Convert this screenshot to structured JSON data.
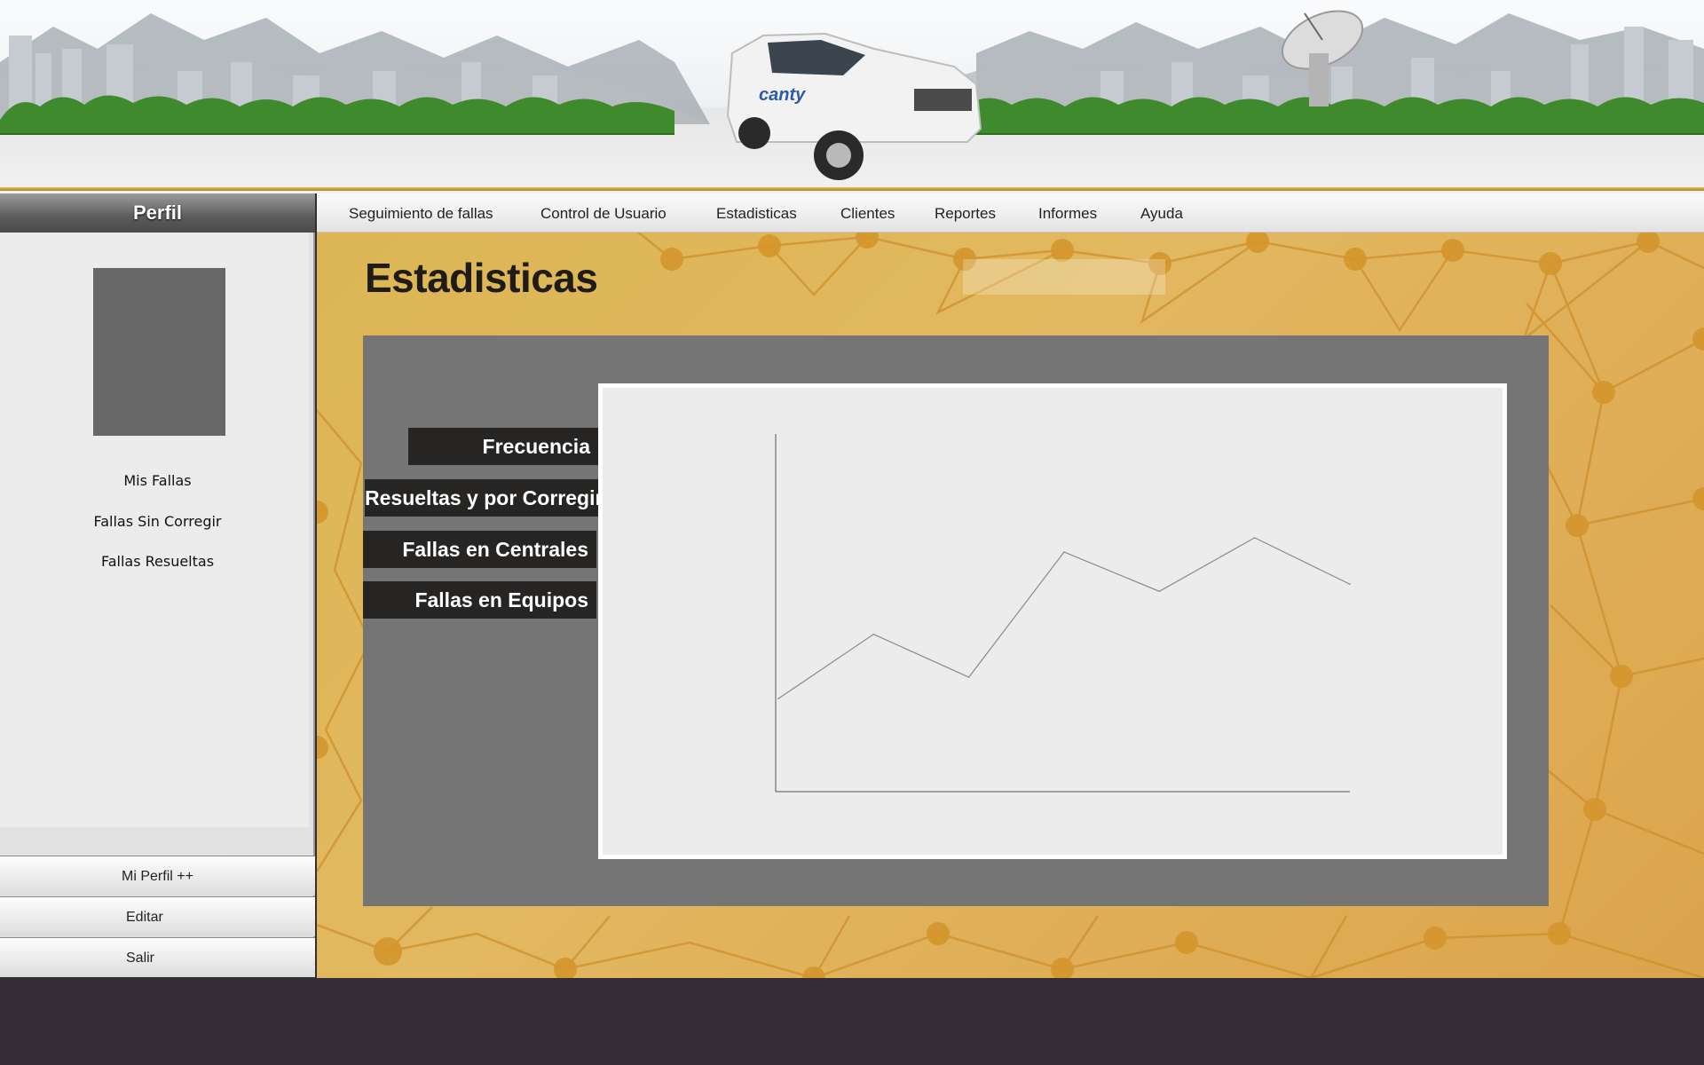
{
  "nav": {
    "items": [
      {
        "label": "Seguimiento de fallas"
      },
      {
        "label": "Control de Usuario"
      },
      {
        "label": "Estadisticas"
      },
      {
        "label": "Clientes"
      },
      {
        "label": "Reportes"
      },
      {
        "label": "Informes"
      },
      {
        "label": "Ayuda"
      }
    ]
  },
  "sidebar": {
    "header": "Perfil",
    "links": [
      {
        "label": "Mis Fallas"
      },
      {
        "label": "Fallas Sin Corregir"
      },
      {
        "label": "Fallas Resueltas"
      }
    ],
    "buttons": [
      {
        "label": "Mi Perfil ++"
      },
      {
        "label": "Editar"
      },
      {
        "label": "Salir"
      }
    ]
  },
  "main": {
    "title": "Estadisticas",
    "search_placeholder": "",
    "tabs": [
      {
        "label": "Frecuencia"
      },
      {
        "label": "Resueltas y por Corregir"
      },
      {
        "label": "Fallas en Centrales"
      },
      {
        "label": "Fallas en Equipos"
      }
    ]
  },
  "banner": {
    "truck_logo": "canty"
  },
  "colors": {
    "background": "#342d35",
    "main_gold": "#dcb654",
    "panel_gray": "#757575",
    "tab_dark": "#262524",
    "chart_bg": "#ececec",
    "line": "#8a8a8a"
  },
  "chart_data": {
    "type": "line",
    "title": "",
    "xlabel": "",
    "ylabel": "",
    "x": [
      1,
      2,
      3,
      4,
      5,
      6,
      7
    ],
    "series": [
      {
        "values": [
          26,
          44,
          32,
          67,
          56,
          71,
          58
        ]
      }
    ],
    "xlim": [
      1,
      7
    ],
    "ylim": [
      0,
      100
    ],
    "grid": false
  }
}
